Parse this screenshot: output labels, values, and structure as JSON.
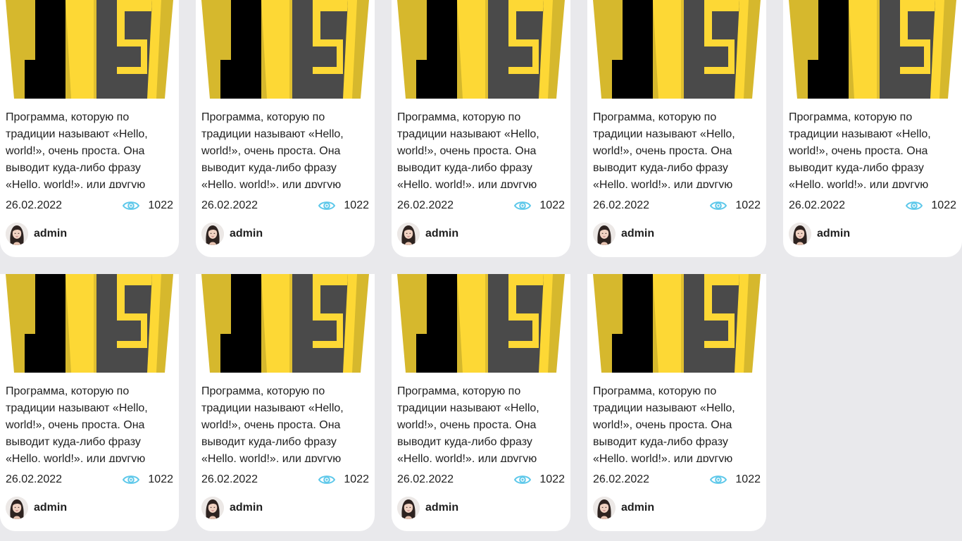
{
  "posts": [
    {
      "excerpt": "Программа, которую по традиции называют «Hello, world!», очень проста. Она выводит куда-либо фразу «Hello, world!», или другую",
      "date": "26.02.2022",
      "views": "1022",
      "author": "admin",
      "thumb_icon": "javascript-logo"
    },
    {
      "excerpt": "Программа, которую по традиции называют «Hello, world!», очень проста. Она выводит куда-либо фразу «Hello, world!», или другую",
      "date": "26.02.2022",
      "views": "1022",
      "author": "admin",
      "thumb_icon": "javascript-logo"
    },
    {
      "excerpt": "Программа, которую по традиции называют «Hello, world!», очень проста. Она выводит куда-либо фразу «Hello, world!», или другую",
      "date": "26.02.2022",
      "views": "1022",
      "author": "admin",
      "thumb_icon": "javascript-logo"
    },
    {
      "excerpt": "Программа, которую по традиции называют «Hello, world!», очень проста. Она выводит куда-либо фразу «Hello, world!», или другую",
      "date": "26.02.2022",
      "views": "1022",
      "author": "admin",
      "thumb_icon": "javascript-logo"
    },
    {
      "excerpt": "Программа, которую по традиции называют «Hello, world!», очень проста. Она выводит куда-либо фразу «Hello, world!», или другую",
      "date": "26.02.2022",
      "views": "1022",
      "author": "admin",
      "thumb_icon": "javascript-logo"
    },
    {
      "excerpt": "Программа, которую по традиции называют «Hello, world!», очень проста. Она выводит куда-либо фразу «Hello, world!», или другую",
      "date": "26.02.2022",
      "views": "1022",
      "author": "admin",
      "thumb_icon": "javascript-logo"
    },
    {
      "excerpt": "Программа, которую по традиции называют «Hello, world!», очень проста. Она выводит куда-либо фразу «Hello, world!», или другую",
      "date": "26.02.2022",
      "views": "1022",
      "author": "admin",
      "thumb_icon": "javascript-logo"
    },
    {
      "excerpt": "Программа, которую по традиции называют «Hello, world!», очень проста. Она выводит куда-либо фразу «Hello, world!», или другую",
      "date": "26.02.2022",
      "views": "1022",
      "author": "admin",
      "thumb_icon": "javascript-logo"
    },
    {
      "excerpt": "Программа, которую по традиции называют «Hello, world!», очень проста. Она выводит куда-либо фразу «Hello, world!», или другую",
      "date": "26.02.2022",
      "views": "1022",
      "author": "admin",
      "thumb_icon": "javascript-logo"
    }
  ],
  "icons": {
    "views": "eye-icon",
    "author": "avatar"
  },
  "colors": {
    "background": "#e9e9ec",
    "card": "#ffffff",
    "eye": "#5ec8ea",
    "logo_gold": "#d6b82d",
    "logo_yellow": "#fdd835",
    "logo_gray": "#4a4a4a",
    "logo_black": "#000000"
  }
}
